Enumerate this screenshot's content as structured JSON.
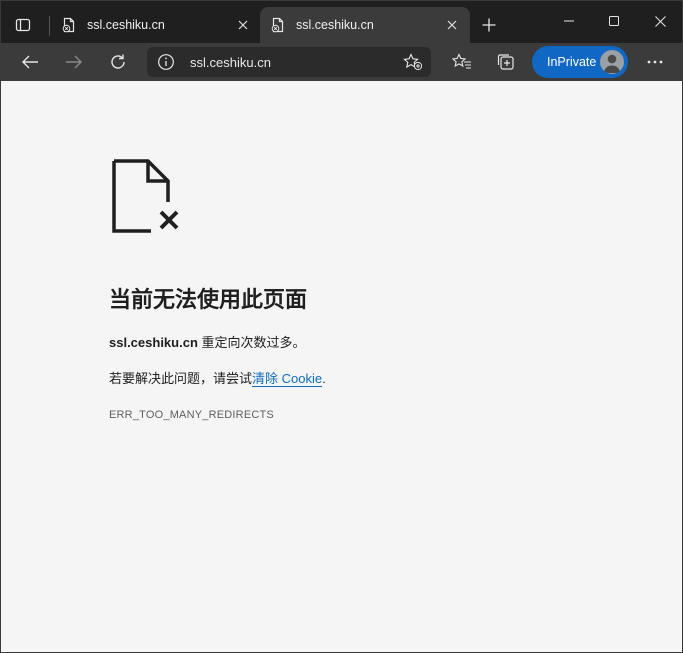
{
  "tabs": [
    {
      "title": "ssl.ceshiku.cn",
      "active": false
    },
    {
      "title": "ssl.ceshiku.cn",
      "active": true
    }
  ],
  "address_bar": {
    "url": "ssl.ceshiku.cn"
  },
  "profile": {
    "label": "InPrivate"
  },
  "error_page": {
    "heading": "当前无法使用此页面",
    "host": "ssl.ceshiku.cn",
    "message_suffix": " 重定向次数过多。",
    "suggestion_prefix": "若要解决此问题，请尝试",
    "suggestion_link": "清除 Cookie",
    "suggestion_suffix": ".",
    "error_code": "ERR_TOO_MANY_REDIRECTS"
  },
  "colors": {
    "accent": "#1067c4",
    "link": "#0f6cbd",
    "tabstrip_bg": "#1f1f1f",
    "toolbar_bg": "#3b3b3b",
    "page_bg": "#f5f5f5"
  },
  "icons": [
    "tab-actions-icon",
    "broken-favicon-icon",
    "close-tab-icon",
    "new-tab-icon",
    "minimize-icon",
    "maximize-icon",
    "close-window-icon",
    "back-icon",
    "forward-icon",
    "refresh-icon",
    "info-icon",
    "add-favorite-icon",
    "favorites-icon",
    "collections-icon",
    "more-icon",
    "broken-page-icon"
  ]
}
